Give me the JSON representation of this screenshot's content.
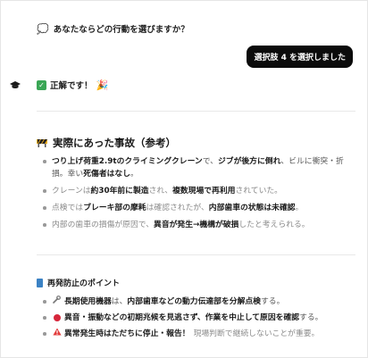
{
  "question": {
    "text": "あなたならどの行動を選びますか？"
  },
  "user_bubble": {
    "text": "選択肢 4 を選択しました"
  },
  "answer": {
    "correct_label": "正解です！"
  },
  "accident": {
    "heading": "実際にあった事故（参考）",
    "bullets": [
      {
        "b1": "つり上げ荷重2.9tのクライミングクレーン",
        "t1": "で、",
        "b2": "ジブが後方に倒れ",
        "t2": "、ビルに衝突・折損。",
        "t3": "幸い",
        "b3": "死傷者はなし",
        "t4": "。"
      },
      {
        "t1": "クレーンは",
        "b1": "約30年前に製造",
        "t2": "され、",
        "b2": "複数現場で再利用",
        "t3": "されていた。"
      },
      {
        "t1": "点検では",
        "b1": "ブレーキ部の摩耗",
        "t2": "は確認されたが、",
        "b2": "内部歯車の状態は未確認",
        "t3": "。"
      },
      {
        "t1": "内部の歯車の損傷が原因で、",
        "b1": "異音が発生→機構が破損",
        "t2": "したと考えられる。"
      }
    ]
  },
  "prevention": {
    "heading": "再発防止のポイント",
    "bullets": [
      {
        "icon": "wrench-icon",
        "b1": "長期使用機器",
        "t1": "は、",
        "b2": "内部歯車などの動力伝達部を分解点検",
        "t2": "する。"
      },
      {
        "icon": "red-circle-icon",
        "b1": "異音・振動などの初期兆候を見逃さず、作業を中止して原因を確認",
        "t1": "する。"
      },
      {
        "icon": "warning-icon",
        "b1": "異常発生時はただちに停止・報告！",
        "t1": "現場判断で継続しないことが重要。"
      }
    ]
  }
}
